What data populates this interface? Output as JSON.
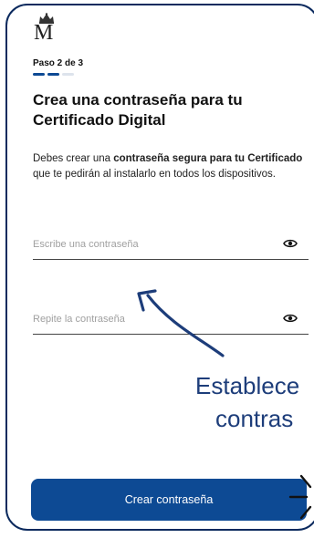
{
  "header": {
    "logo_letter": "M",
    "step_label": "Paso 2 de 3",
    "progress": {
      "current": 2,
      "total": 3
    }
  },
  "main": {
    "title": "Crea una contraseña para tu Certificado Digital",
    "description": {
      "part1": "Debes crear una ",
      "bold1": "contraseña segura para tu",
      "part2": " ",
      "bold2": "Certificado",
      "part3": " que te pedirán al instalarlo en todos los dispositivos."
    },
    "password_field": {
      "placeholder": "Escribe una contraseña",
      "value": ""
    },
    "repeat_field": {
      "placeholder": "Repite la contraseña",
      "value": ""
    },
    "submit_label": "Crear contraseña"
  },
  "overlay": {
    "line1": "Establece",
    "line2": "contras"
  },
  "colors": {
    "primary": "#0d4a94",
    "progress_active": "#0d4a94",
    "progress_inactive": "#dde3ec",
    "annotation": "#1d3d7a",
    "frame": "#0b2a5e"
  },
  "icons": {
    "logo": "royal-crown-icon",
    "show_password": "eye-icon"
  }
}
